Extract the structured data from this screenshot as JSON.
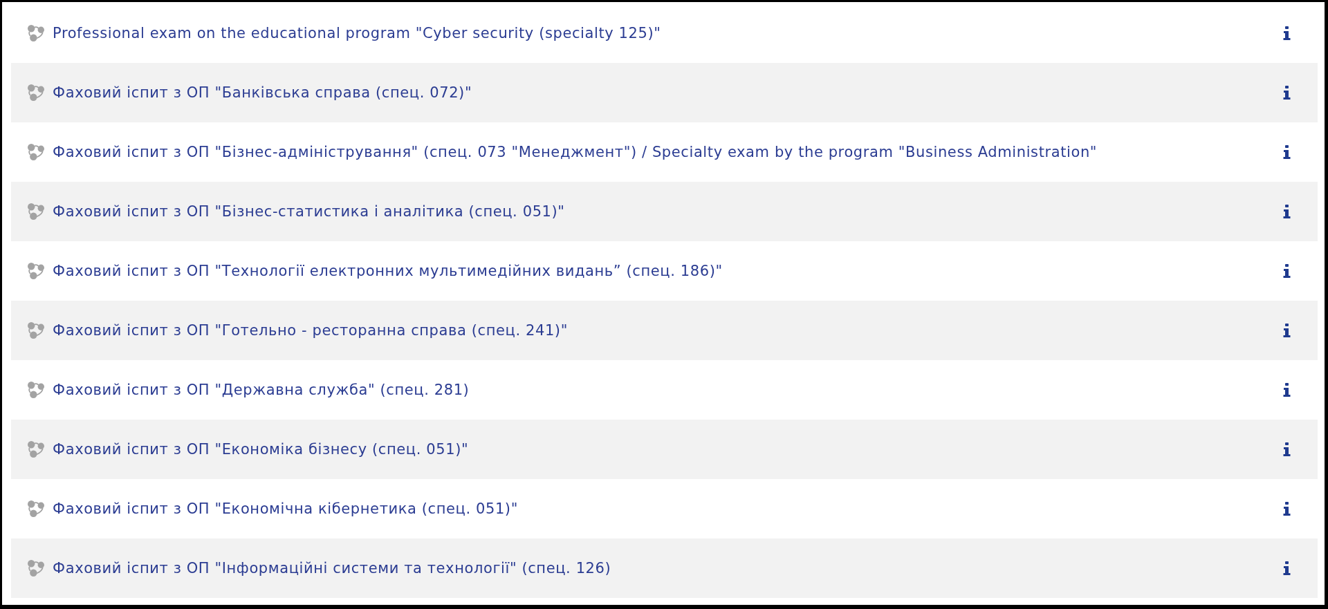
{
  "items": [
    {
      "title": "Professional exam on the educational program \"Cyber security (specialty 125)\""
    },
    {
      "title": "Фаховий іспит з ОП \"Банківська справа (спец. 072)\""
    },
    {
      "title": "Фаховий іспит з ОП \"Бізнес-адміністрування\" (спец. 073 \"Менеджмент\") / Specialty exam by the program \"Business Administration\""
    },
    {
      "title": "Фаховий іспит з ОП \"Бізнес-статистика і аналітика (спец. 051)\""
    },
    {
      "title": "Фаховий іспит з ОП \"Технології електронних мультимедійних видань” (спец. 186)\""
    },
    {
      "title": "Фаховий іспит з ОП \"Готельно - ресторанна справа (спец. 241)\""
    },
    {
      "title": "Фаховий іспит з ОП \"Державна служба\" (спец. 281)"
    },
    {
      "title": "Фаховий іспит з ОП \"Економіка бізнесу (спец. 051)\""
    },
    {
      "title": "Фаховий іспит з ОП \"Економічна кібернетика (спец. 051)\""
    },
    {
      "title": "Фаховий іспит з ОП \"Інформаційні системи та технології\" (спец. 126)"
    }
  ]
}
